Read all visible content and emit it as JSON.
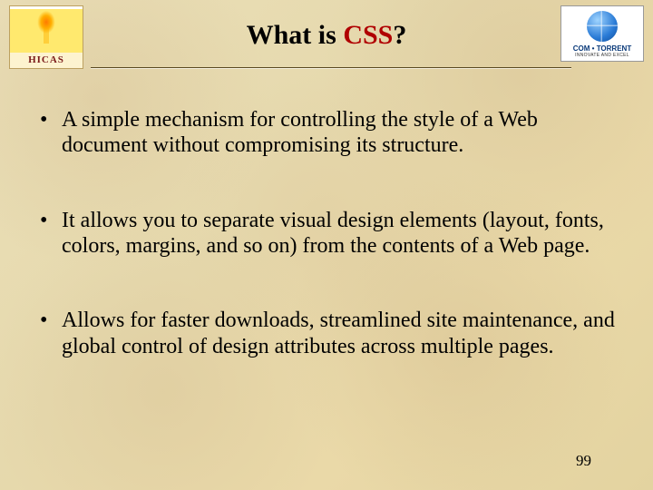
{
  "logos": {
    "left": {
      "name": "hicas-logo",
      "label": "HICAS"
    },
    "right": {
      "name": "com-torrent-logo",
      "brand": "COM • TORRENT",
      "sub": "INNOVATE AND EXCEL"
    }
  },
  "title": {
    "prefix": "What is ",
    "emph": "CSS",
    "suffix": "?"
  },
  "bullets": [
    "A simple mechanism for controlling the style of a Web document without compromising its structure.",
    "It allows you to separate visual design elements (layout, fonts, colors, margins, and so on) from the contents of a Web page.",
    "Allows for faster downloads, streamlined site maintenance, and global control of design attributes across multiple pages."
  ],
  "page_number": "99"
}
